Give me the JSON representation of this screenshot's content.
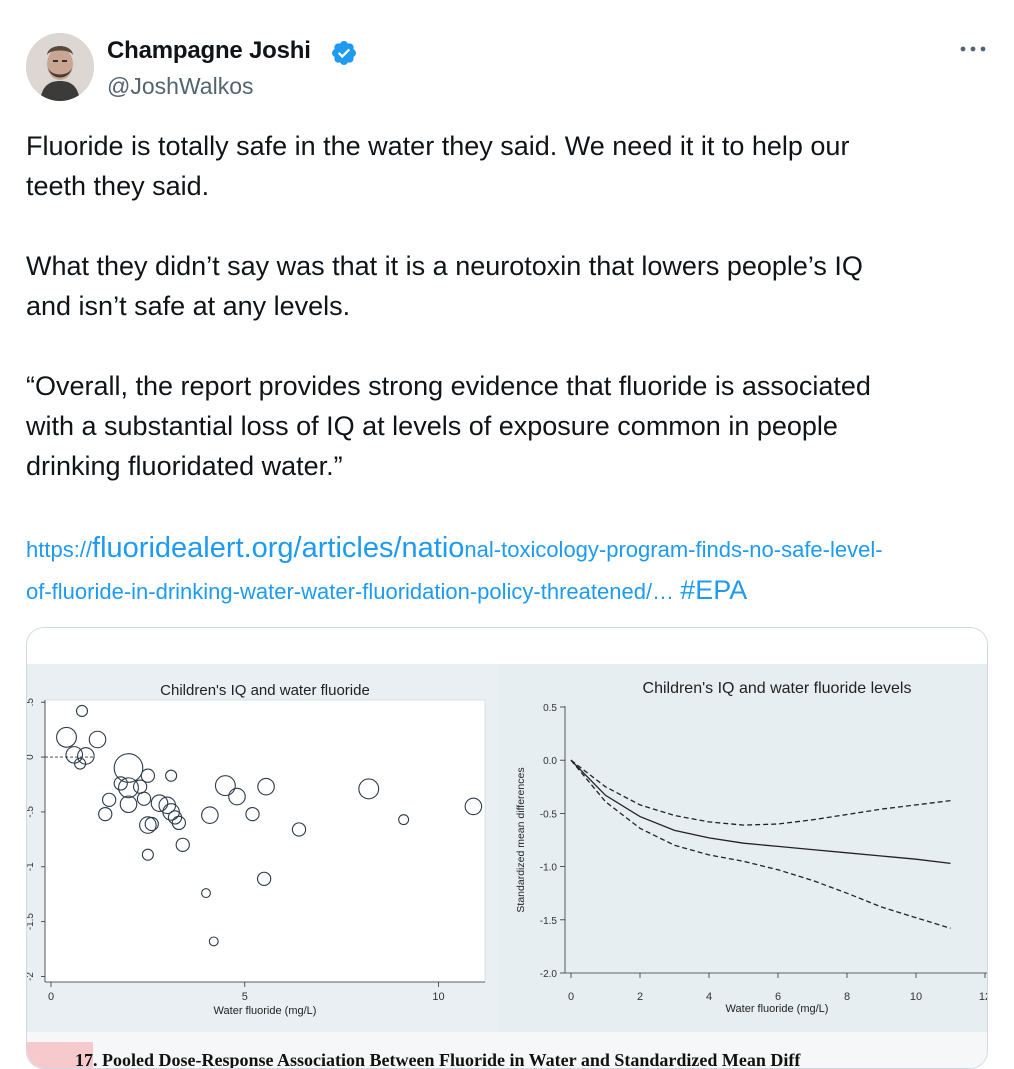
{
  "author": {
    "name": "Champagne Joshi",
    "handle": "@JoshWalkos",
    "verified": true,
    "badge_color": "#1d9bf0"
  },
  "tweet": {
    "paragraph1_line1": "Fluoride is totally safe in the water they said. We need it it to help our",
    "paragraph1_line2": "teeth they said.",
    "paragraph2_line1": "What they didn’t say was that it is a neurotoxin that lowers people’s IQ",
    "paragraph2_line2": "and isn’t safe at any levels.",
    "quote_line1": "“Overall, the report provides strong evidence that fluoride is associated",
    "quote_line2": "with a substantial loss of IQ at levels of exposure common in people",
    "quote_line3": "drinking fluoridated water.”",
    "link_prefix": "https://",
    "link_big": "fluoridealert.org/articles/natio",
    "link_rest1": "nal-toxicology-program-finds-no-safe-level-",
    "link_rest2": "of-fluoride-in-drinking-water-water-fluoridation-policy-threatened/…",
    "hashtag": "#EPA",
    "link_color": "#1d9bf0"
  },
  "image": {
    "footer_text": "17. Pooled Dose-Response Association Between Fluoride in Water and Standardized Mean Diff"
  },
  "chart_data": [
    {
      "type": "scatter",
      "title": "Children's IQ and water fluoride",
      "xlabel": "Water fluoride (mg/L)",
      "ylabel": "",
      "x_ticks": [
        "0",
        "5",
        "10"
      ],
      "y_ticks": [
        ".5",
        "0",
        "-.5",
        "-1",
        "-1.5",
        "-2"
      ],
      "xlim": [
        0,
        11.2
      ],
      "ylim": [
        -2.05,
        0.52
      ],
      "points": [
        {
          "x": 0.8,
          "y": 0.42,
          "r": 1.0
        },
        {
          "x": 0.4,
          "y": 0.18,
          "r": 1.8
        },
        {
          "x": 0.6,
          "y": 0.02,
          "r": 1.5
        },
        {
          "x": 0.75,
          "y": -0.06,
          "r": 1.0
        },
        {
          "x": 0.9,
          "y": 0.01,
          "r": 1.5
        },
        {
          "x": 1.2,
          "y": 0.16,
          "r": 1.5
        },
        {
          "x": 2.0,
          "y": -0.1,
          "r": 2.6
        },
        {
          "x": 2.5,
          "y": -0.17,
          "r": 1.2
        },
        {
          "x": 3.1,
          "y": -0.17,
          "r": 1.0
        },
        {
          "x": 1.8,
          "y": -0.24,
          "r": 1.2
        },
        {
          "x": 2.0,
          "y": -0.28,
          "r": 1.8
        },
        {
          "x": 2.3,
          "y": -0.27,
          "r": 1.2
        },
        {
          "x": 1.5,
          "y": -0.39,
          "r": 1.2
        },
        {
          "x": 2.0,
          "y": -0.43,
          "r": 1.5
        },
        {
          "x": 2.4,
          "y": -0.38,
          "r": 1.2
        },
        {
          "x": 2.8,
          "y": -0.42,
          "r": 1.5
        },
        {
          "x": 3.0,
          "y": -0.44,
          "r": 1.5
        },
        {
          "x": 3.1,
          "y": -0.5,
          "r": 1.5
        },
        {
          "x": 3.2,
          "y": -0.55,
          "r": 1.2
        },
        {
          "x": 3.3,
          "y": -0.6,
          "r": 1.2
        },
        {
          "x": 2.6,
          "y": -0.61,
          "r": 1.2
        },
        {
          "x": 1.4,
          "y": -0.52,
          "r": 1.2
        },
        {
          "x": 2.5,
          "y": -0.62,
          "r": 1.5
        },
        {
          "x": 4.5,
          "y": -0.26,
          "r": 1.8
        },
        {
          "x": 4.8,
          "y": -0.36,
          "r": 1.5
        },
        {
          "x": 5.55,
          "y": -0.27,
          "r": 1.5
        },
        {
          "x": 4.1,
          "y": -0.53,
          "r": 1.5
        },
        {
          "x": 5.2,
          "y": -0.52,
          "r": 1.2
        },
        {
          "x": 8.2,
          "y": -0.29,
          "r": 1.8
        },
        {
          "x": 6.4,
          "y": -0.66,
          "r": 1.2
        },
        {
          "x": 9.1,
          "y": -0.57,
          "r": 0.9
        },
        {
          "x": 10.9,
          "y": -0.45,
          "r": 1.5
        },
        {
          "x": 3.4,
          "y": -0.8,
          "r": 1.2
        },
        {
          "x": 2.5,
          "y": -0.89,
          "r": 1.0
        },
        {
          "x": 5.5,
          "y": -1.11,
          "r": 1.2
        },
        {
          "x": 4.0,
          "y": -1.24,
          "r": 0.8
        },
        {
          "x": 4.2,
          "y": -1.68,
          "r": 0.8
        }
      ]
    },
    {
      "type": "line",
      "title": "Children's IQ and water fluoride levels",
      "xlabel": "Water fluoride (mg/L)",
      "ylabel": "Standardized mean differences",
      "x_ticks": [
        "0",
        "2",
        "4",
        "6",
        "8",
        "10",
        "12"
      ],
      "y_ticks": [
        "0.5",
        "0.0",
        "-0.5",
        "-1.0",
        "-1.5",
        "-2.0"
      ],
      "xlim": [
        0,
        12
      ],
      "ylim": [
        -2.0,
        0.5
      ],
      "x": [
        0,
        1,
        2,
        3,
        4,
        5,
        6,
        7,
        8,
        9,
        10,
        11
      ],
      "series": [
        {
          "values": [
            0,
            -0.33,
            -0.53,
            -0.66,
            -0.73,
            -0.78,
            -0.81,
            -0.84,
            -0.87,
            -0.9,
            -0.93,
            -0.97
          ],
          "style": "solid"
        },
        {
          "values": [
            0,
            -0.25,
            -0.42,
            -0.52,
            -0.58,
            -0.61,
            -0.6,
            -0.56,
            -0.51,
            -0.46,
            -0.42,
            -0.38
          ],
          "style": "dashed"
        },
        {
          "values": [
            0,
            -0.39,
            -0.64,
            -0.8,
            -0.89,
            -0.95,
            -1.03,
            -1.13,
            -1.25,
            -1.38,
            -1.48,
            -1.58
          ],
          "style": "dashed"
        }
      ]
    }
  ]
}
